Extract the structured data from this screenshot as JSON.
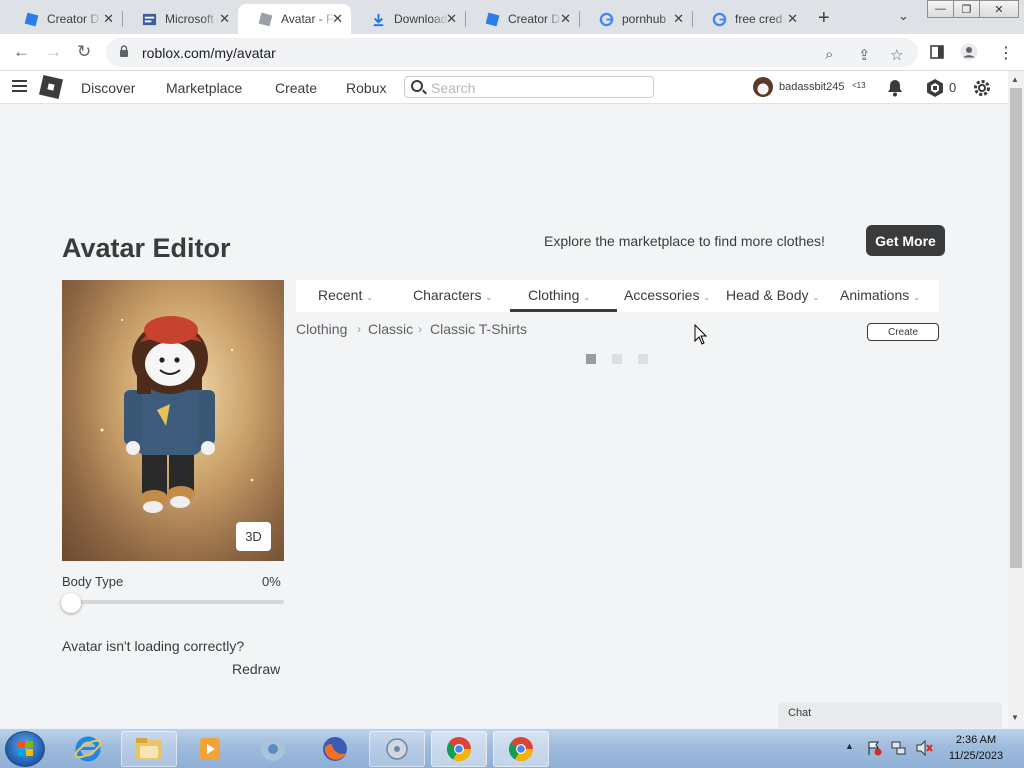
{
  "browser": {
    "tabs": [
      {
        "title": "Creator D",
        "icon": "roblox-studio-icon"
      },
      {
        "title": "Microsoft",
        "icon": "microsoft-icon"
      },
      {
        "title": "Avatar - R",
        "icon": "roblox-icon"
      },
      {
        "title": "Download",
        "icon": "download-icon"
      },
      {
        "title": "Creator D",
        "icon": "roblox-studio-icon"
      },
      {
        "title": "pornhub",
        "icon": "google-icon"
      },
      {
        "title": "free cred",
        "icon": "google-icon"
      }
    ],
    "active_tab_index": 2,
    "url": "roblox.com/my/avatar"
  },
  "header": {
    "nav": [
      "Discover",
      "Marketplace",
      "Create",
      "Robux"
    ],
    "search_placeholder": "Search",
    "username": "badassbit245",
    "age_label": "<13",
    "robux": "0"
  },
  "editor": {
    "title": "Avatar Editor",
    "explore_text": "Explore the marketplace to find more clothes!",
    "get_more": "Get More",
    "view_3d": "3D",
    "body_type_label": "Body Type",
    "body_type_value": "0%",
    "body_type_fraction": 0,
    "loading_question": "Avatar isn't loading correctly?",
    "redraw": "Redraw",
    "category_tabs": [
      "Recent",
      "Characters",
      "Clothing",
      "Accessories",
      "Head & Body",
      "Animations"
    ],
    "active_category": "Clothing",
    "breadcrumb": [
      "Clothing",
      "Classic",
      "Classic T-Shirts"
    ],
    "create_button": "Create"
  },
  "chat": {
    "label": "Chat"
  },
  "taskbar": {
    "apps": [
      "internet-explorer-icon",
      "file-explorer-icon",
      "media-player-icon",
      "chrome-icon",
      "firefox-icon",
      "media-center-icon",
      "chrome-icon",
      "chrome-icon"
    ],
    "time": "2:36 AM",
    "date": "11/25/2023"
  },
  "colors": {
    "accent": "#393b3d",
    "page_bg": "#f2f4f5",
    "taskbar": "#9fbbdc"
  }
}
